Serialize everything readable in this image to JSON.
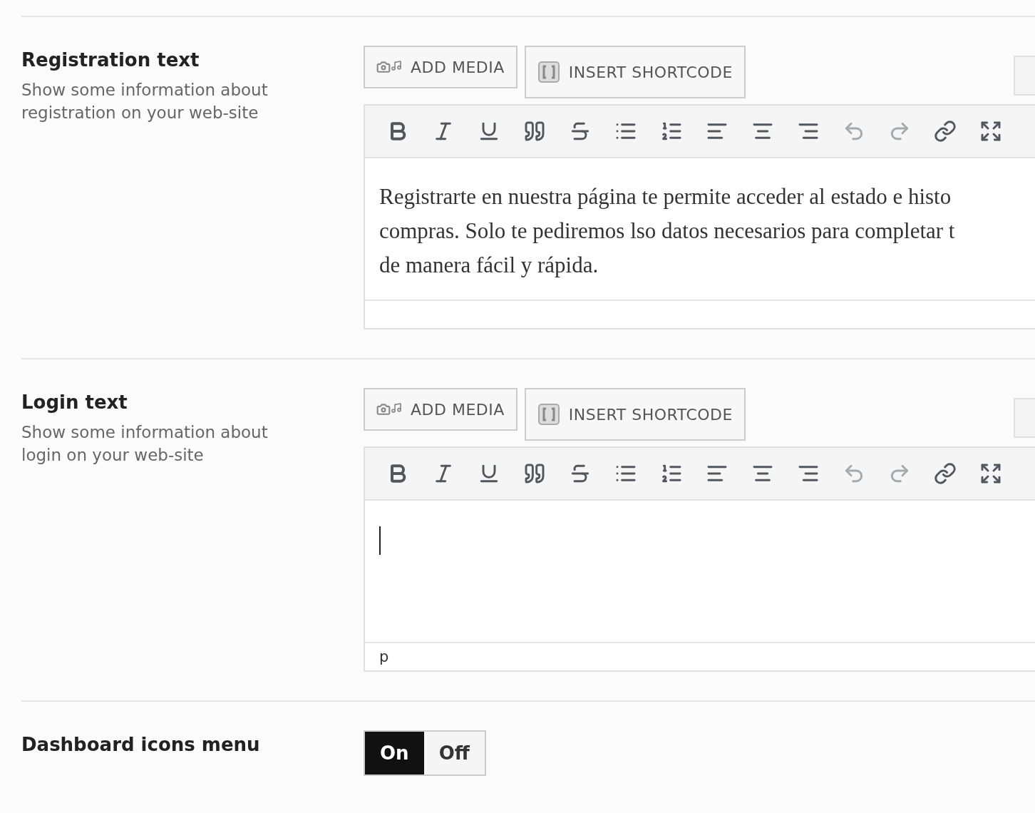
{
  "sections": [
    {
      "kind": "editor",
      "title": "Registration text",
      "description": [
        "Show some information about",
        "registration on your web-site"
      ],
      "media_button": "ADD MEDIA",
      "shortcode_button": "INSERT SHORTCODE",
      "toolbar": [
        {
          "kind": "bold",
          "disabled": false
        },
        {
          "kind": "italic",
          "disabled": false
        },
        {
          "kind": "underline",
          "disabled": false
        },
        {
          "kind": "quote",
          "disabled": false
        },
        {
          "kind": "strike",
          "disabled": false
        },
        {
          "kind": "bullets",
          "disabled": false
        },
        {
          "kind": "numbers",
          "disabled": false
        },
        {
          "kind": "align-left",
          "disabled": false
        },
        {
          "kind": "align-center",
          "disabled": false
        },
        {
          "kind": "align-right",
          "disabled": false
        },
        {
          "kind": "undo",
          "disabled": true
        },
        {
          "kind": "redo",
          "disabled": true
        },
        {
          "kind": "link",
          "disabled": false
        },
        {
          "kind": "fullscreen",
          "disabled": false
        }
      ],
      "content_lines": [
        "Registrarte en nuestra página te permite acceder al estado e histo",
        "compras. Solo te pediremos lso datos necesarios para completar t",
        "de manera fácil y rápida."
      ],
      "focused": false
    },
    {
      "kind": "editor",
      "title": "Login text",
      "description": [
        "Show some information about",
        "login on your web-site"
      ],
      "media_button": "ADD MEDIA",
      "shortcode_button": "INSERT SHORTCODE",
      "toolbar": [
        {
          "kind": "bold",
          "disabled": false
        },
        {
          "kind": "italic",
          "disabled": false
        },
        {
          "kind": "underline",
          "disabled": false
        },
        {
          "kind": "quote",
          "disabled": false
        },
        {
          "kind": "strike",
          "disabled": false
        },
        {
          "kind": "bullets",
          "disabled": false
        },
        {
          "kind": "numbers",
          "disabled": false
        },
        {
          "kind": "align-left",
          "disabled": false
        },
        {
          "kind": "align-center",
          "disabled": false
        },
        {
          "kind": "align-right",
          "disabled": false
        },
        {
          "kind": "undo",
          "disabled": true
        },
        {
          "kind": "redo",
          "disabled": true
        },
        {
          "kind": "link",
          "disabled": false
        },
        {
          "kind": "fullscreen",
          "disabled": false
        }
      ],
      "focused": true,
      "path": "p"
    },
    {
      "kind": "toggle",
      "title": "Dashboard icons menu",
      "options": [
        {
          "label": "On",
          "selected": true
        },
        {
          "label": "Off",
          "selected": false
        }
      ]
    }
  ]
}
